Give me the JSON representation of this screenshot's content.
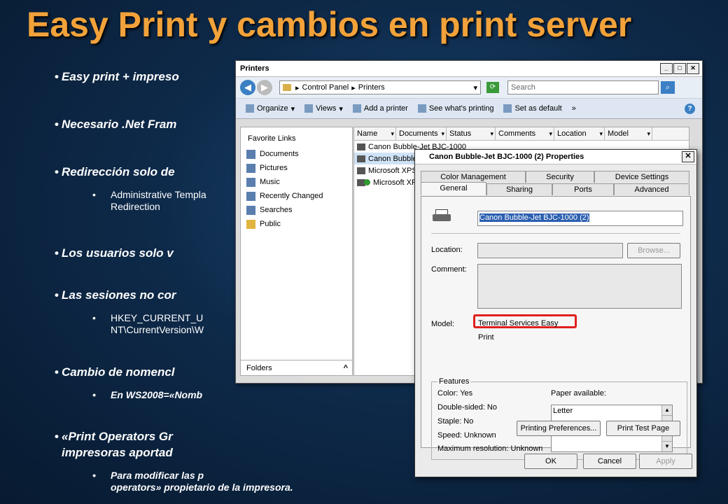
{
  "slide": {
    "title": "Easy Print y cambios en print server",
    "bullets": [
      "Easy print + impreso",
      "Necesario .Net Fram",
      "Redirección solo de",
      "Los usuarios solo v",
      "Las sesiones no cor",
      "Cambio de nomencl",
      "«Print Operators Gr",
      "impresoras aportad"
    ],
    "sub_bullets": [
      "Administrative Templa",
      "Redirection",
      "HKEY_CURRENT_U",
      "NT\\CurrentVersion\\W",
      "En WS2008=«Nomb",
      "Para modificar las p",
      "operators» propietario de la impresora."
    ]
  },
  "explorer": {
    "title": "Printers",
    "address_parts": [
      "Control Panel",
      "Printers"
    ],
    "search_placeholder": "Search",
    "toolbar": [
      "Organize",
      "Views",
      "Add a printer",
      "See what's printing",
      "Set as default",
      "»"
    ],
    "favorite_links_title": "Favorite Links",
    "favorite_links": [
      "Documents",
      "Pictures",
      "Music",
      "Recently Changed",
      "Searches",
      "Public"
    ],
    "folders_label": "Folders",
    "columns": [
      "Name",
      "Documents",
      "Status",
      "Comments",
      "Location",
      "Model"
    ],
    "printers": [
      "Canon Bubble-Jet BJC-1000",
      "Canon Bubble",
      "Microsoft XPS",
      "Microsoft XPS"
    ]
  },
  "dialog": {
    "title": "Canon Bubble-Jet BJC-1000 (2) Properties",
    "tabs_row1": [
      "Color Management",
      "Security",
      "Device Settings"
    ],
    "tabs_row2": [
      "General",
      "Sharing",
      "Ports",
      "Advanced"
    ],
    "active_tab": "General",
    "printer_name": "Canon Bubble-Jet BJC-1000 (2)",
    "location_label": "Location:",
    "browse_label": "Browse...",
    "comment_label": "Comment:",
    "model_label": "Model:",
    "model_value": "Terminal Services Easy Print",
    "features_label": "Features",
    "features": {
      "color": "Color: Yes",
      "double_sided": "Double-sided: No",
      "staple": "Staple: No",
      "speed": "Speed: Unknown",
      "max_res": "Maximum resolution: Unknown"
    },
    "paper_available_label": "Paper available:",
    "paper_list": [
      "Letter"
    ],
    "printing_prefs_label": "Printing Preferences...",
    "print_test_label": "Print Test Page",
    "ok_label": "OK",
    "cancel_label": "Cancel",
    "apply_label": "Apply"
  },
  "colors": {
    "title": "#f2a23a",
    "highlight": "#e0201e",
    "selection": "#2b5fb0"
  }
}
